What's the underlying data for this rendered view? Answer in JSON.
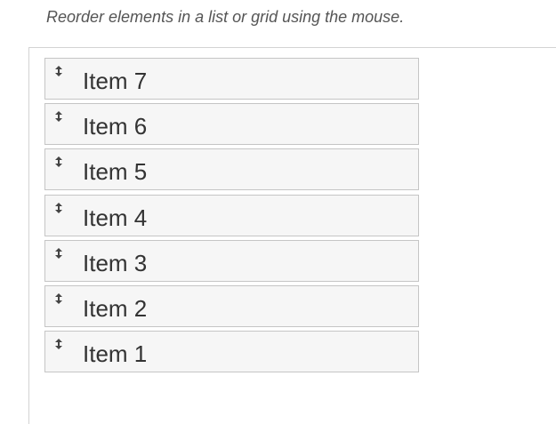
{
  "description": "Reorder elements in a list or grid using the mouse.",
  "sortable": {
    "icon": "arrow-up-down-icon",
    "items": [
      {
        "label": "Item 7"
      },
      {
        "label": "Item 6"
      },
      {
        "label": "Item 5"
      },
      {
        "label": "Item 4"
      },
      {
        "label": "Item 3"
      },
      {
        "label": "Item 2"
      },
      {
        "label": "Item 1"
      }
    ]
  },
  "colors": {
    "item_background": "#f6f6f6",
    "item_border": "#c5c5c5",
    "text": "#333333",
    "description_text": "#555555"
  }
}
